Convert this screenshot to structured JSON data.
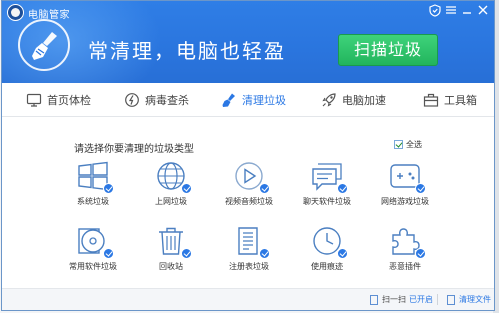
{
  "window": {
    "app_title": "电脑管家",
    "slogan": "常清理，电脑也轻盈",
    "scan_button": "扫描垃圾",
    "controls": [
      "shield-icon",
      "menu-icon",
      "minimize-icon",
      "close-icon"
    ]
  },
  "tabs": [
    {
      "label": "首页体检",
      "icon": "monitor-icon",
      "active": false
    },
    {
      "label": "病毒查杀",
      "icon": "virus-scan-icon",
      "active": false
    },
    {
      "label": "清理垃圾",
      "icon": "broom-icon",
      "active": true
    },
    {
      "label": "电脑加速",
      "icon": "rocket-icon",
      "active": false
    },
    {
      "label": "工具箱",
      "icon": "toolbox-icon",
      "active": false
    }
  ],
  "content": {
    "prompt": "请选择你要清理的垃圾类型",
    "select_all": "全选",
    "select_all_checked": true,
    "items": [
      {
        "label": "系统垃圾",
        "icon": "windows-icon",
        "checked": true
      },
      {
        "label": "上网垃圾",
        "icon": "globe-icon",
        "checked": true
      },
      {
        "label": "视频音频垃圾",
        "icon": "play-icon",
        "checked": true
      },
      {
        "label": "聊天软件垃圾",
        "icon": "chat-icon",
        "checked": true
      },
      {
        "label": "网络游戏垃圾",
        "icon": "gamepad-icon",
        "checked": true
      },
      {
        "label": "常用软件垃圾",
        "icon": "disc-icon",
        "checked": true
      },
      {
        "label": "回收站",
        "icon": "trash-icon",
        "checked": true
      },
      {
        "label": "注册表垃圾",
        "icon": "registry-icon",
        "checked": true
      },
      {
        "label": "使用痕迹",
        "icon": "clock-icon",
        "checked": true
      },
      {
        "label": "恶意插件",
        "icon": "puzzle-icon",
        "checked": true
      }
    ]
  },
  "footer": {
    "scan_label": "扫一扫",
    "scan_status": "已开启",
    "files_label": "清理文件"
  },
  "colors": {
    "header_blue": "#2a75de",
    "accent_blue": "#2b78e4",
    "scan_green": "#22b45d"
  }
}
